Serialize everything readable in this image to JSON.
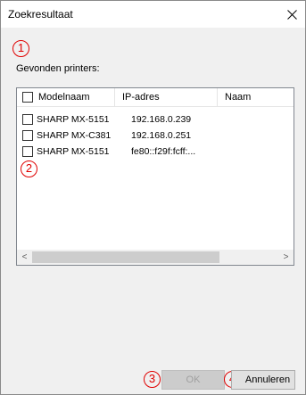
{
  "window": {
    "title": "Zoekresultaat"
  },
  "markers": [
    "1",
    "2",
    "3",
    "4"
  ],
  "found_label": "Gevonden printers:",
  "table": {
    "columns": [
      "Modelnaam",
      "IP-adres",
      "Naam"
    ],
    "rows": [
      {
        "model": "SHARP MX-5151",
        "ip": "192.168.0.239",
        "name": ""
      },
      {
        "model": "SHARP MX-C381",
        "ip": "192.168.0.251",
        "name": ""
      },
      {
        "model": "SHARP MX-5151",
        "ip": "fe80::f29f:fcff:...",
        "name": ""
      }
    ]
  },
  "scrollbar": {
    "left_arrow": "<",
    "right_arrow": ">"
  },
  "buttons": {
    "ok": "OK",
    "cancel": "Annuleren"
  },
  "colors": {
    "marker": "#e00000",
    "button_face": "#e1e1e1",
    "disabled_text": "#a0a0a0"
  }
}
